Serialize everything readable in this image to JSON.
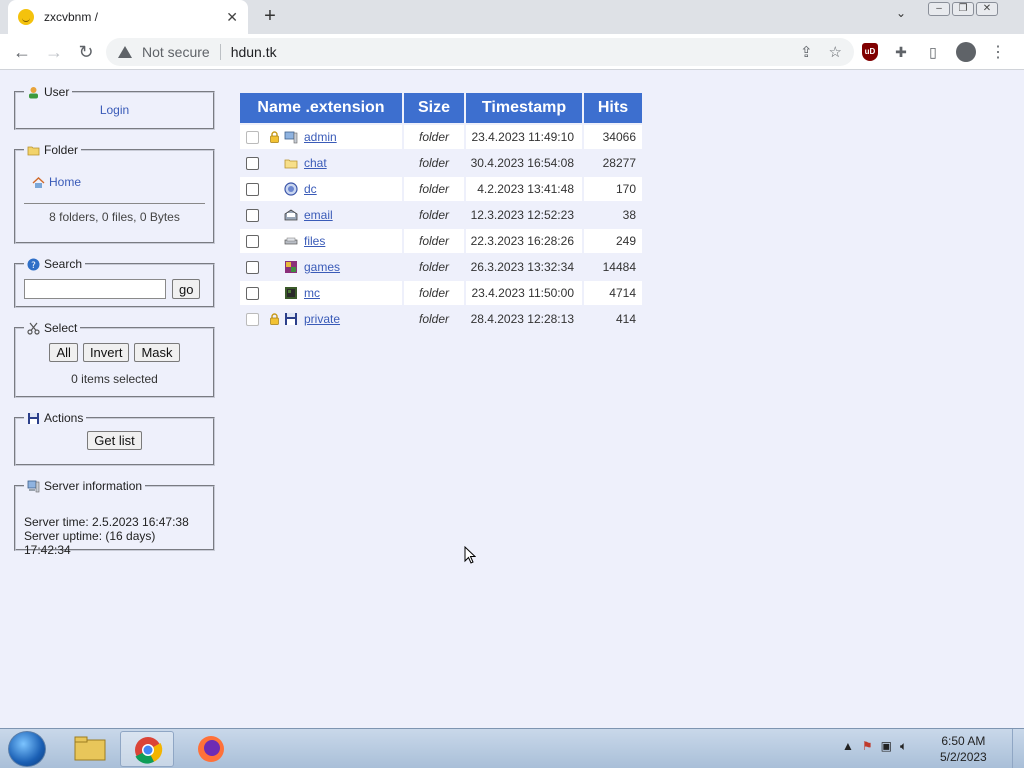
{
  "browser": {
    "tab_title": "zxcvbnm /",
    "tab_close": "✕",
    "new_tab": "+",
    "not_secure": "Not secure",
    "url": "hdun.tk",
    "ublock_label": "uD"
  },
  "sidebar": {
    "user": {
      "legend": "User",
      "login": "Login"
    },
    "folder": {
      "legend": "Folder",
      "home": "Home",
      "info": "8 folders, 0 files, 0 Bytes"
    },
    "search": {
      "legend": "Search",
      "placeholder": "",
      "go": "go"
    },
    "select": {
      "legend": "Select",
      "all": "All",
      "invert": "Invert",
      "mask": "Mask",
      "status": "0 items selected"
    },
    "actions": {
      "legend": "Actions",
      "get_list": "Get list"
    },
    "server": {
      "legend": "Server information",
      "time": "Server time: 2.5.2023 16:47:38",
      "uptime": "Server uptime: (16 days) 17:42:34"
    }
  },
  "table": {
    "headers": [
      "Name .extension",
      "Size",
      "Timestamp",
      "Hits"
    ],
    "rows": [
      {
        "name": "admin",
        "size": "folder",
        "timestamp": "23.4.2023 11:49:10",
        "hits": "34066",
        "locked": true,
        "icon": "computer-folder-icon"
      },
      {
        "name": "chat",
        "size": "folder",
        "timestamp": "30.4.2023 16:54:08",
        "hits": "28277",
        "locked": false,
        "icon": "folder-icon"
      },
      {
        "name": "dc",
        "size": "folder",
        "timestamp": "4.2.2023 13:41:48",
        "hits": "170",
        "locked": false,
        "icon": "dc-icon"
      },
      {
        "name": "email",
        "size": "folder",
        "timestamp": "12.3.2023 12:52:23",
        "hits": "38",
        "locked": false,
        "icon": "email-icon"
      },
      {
        "name": "files",
        "size": "folder",
        "timestamp": "22.3.2023 16:28:26",
        "hits": "249",
        "locked": false,
        "icon": "files-icon"
      },
      {
        "name": "games",
        "size": "folder",
        "timestamp": "26.3.2023 13:32:34",
        "hits": "14484",
        "locked": false,
        "icon": "games-icon"
      },
      {
        "name": "mc",
        "size": "folder",
        "timestamp": "23.4.2023 11:50:00",
        "hits": "4714",
        "locked": false,
        "icon": "mc-icon"
      },
      {
        "name": "private",
        "size": "folder",
        "timestamp": "28.4.2023 12:28:13",
        "hits": "414",
        "locked": true,
        "icon": "floppy-icon"
      }
    ]
  },
  "taskbar": {
    "time": "6:50 AM",
    "date": "5/2/2023"
  },
  "colors": {
    "header_blue": "#3d6fcf",
    "link_blue": "#3a5bb8",
    "page_bg": "#eef0fb"
  }
}
